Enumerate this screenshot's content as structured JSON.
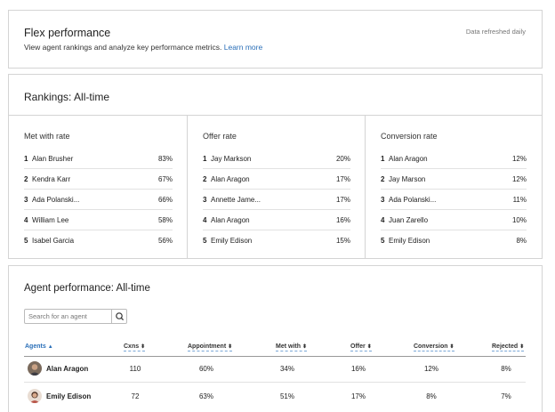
{
  "header": {
    "title": "Flex performance",
    "subtitle": "View agent rankings and analyze key performance metrics.",
    "learn_more": "Learn more",
    "refresh_note": "Data refreshed daily"
  },
  "rankings": {
    "title": "Rankings: All-time",
    "columns": [
      {
        "heading": "Met with rate",
        "rows": [
          {
            "rank": "1",
            "name": "Alan Brusher",
            "value": "83%"
          },
          {
            "rank": "2",
            "name": "Kendra Karr",
            "value": "67%"
          },
          {
            "rank": "3",
            "name": "Ada Polanski...",
            "value": "66%"
          },
          {
            "rank": "4",
            "name": "William Lee",
            "value": "58%"
          },
          {
            "rank": "5",
            "name": "Isabel Garcia",
            "value": "56%"
          }
        ]
      },
      {
        "heading": "Offer rate",
        "rows": [
          {
            "rank": "1",
            "name": "Jay Markson",
            "value": "20%"
          },
          {
            "rank": "2",
            "name": "Alan Aragon",
            "value": "17%"
          },
          {
            "rank": "3",
            "name": "Annette Jame...",
            "value": "17%"
          },
          {
            "rank": "4",
            "name": "Alan Aragon",
            "value": "16%"
          },
          {
            "rank": "5",
            "name": "Emily Edison",
            "value": "15%"
          }
        ]
      },
      {
        "heading": "Conversion rate",
        "rows": [
          {
            "rank": "1",
            "name": "Alan Aragon",
            "value": "12%"
          },
          {
            "rank": "2",
            "name": "Jay Marson",
            "value": "12%"
          },
          {
            "rank": "3",
            "name": "Ada Polanski...",
            "value": "11%"
          },
          {
            "rank": "4",
            "name": "Juan Zarello",
            "value": "10%"
          },
          {
            "rank": "5",
            "name": "Emily Edison",
            "value": "8%"
          }
        ]
      }
    ]
  },
  "agent_performance": {
    "title": "Agent performance: All-time",
    "search_placeholder": "Search for an agent",
    "columns": {
      "agents": "Agents",
      "cxns": "Cxns",
      "appointment": "Appointment",
      "met_with": "Met with",
      "offer": "Offer",
      "conversion": "Conversion",
      "rejected": "Rejected"
    },
    "sort_up_glyph": "▲",
    "sort_glyph": "⬍",
    "rows": [
      {
        "name": "Alan Aragon",
        "cxns": "110",
        "appointment": "60%",
        "met_with": "34%",
        "offer": "16%",
        "conversion": "12%",
        "rejected": "8%"
      },
      {
        "name": "Emily Edison",
        "cxns": "72",
        "appointment": "63%",
        "met_with": "51%",
        "offer": "17%",
        "conversion": "8%",
        "rejected": "7%"
      }
    ]
  },
  "colors": {
    "link": "#2a6fb8",
    "border": "#d4d4d4"
  }
}
